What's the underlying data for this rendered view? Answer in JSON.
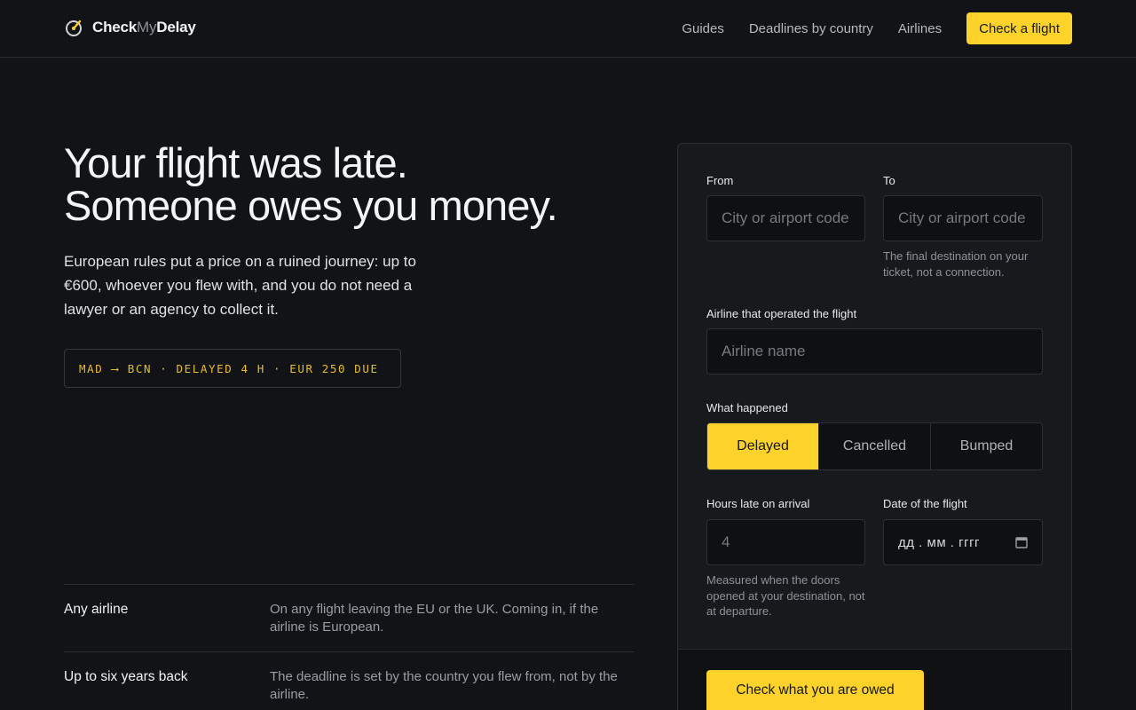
{
  "brand": {
    "name_start": "Check",
    "name_mid": "My",
    "name_end": "Delay"
  },
  "nav": {
    "links": [
      "Guides",
      "Deadlines by country",
      "Airlines"
    ],
    "cta": "Check a flight"
  },
  "hero": {
    "title_line1": "Your flight was late.",
    "title_line2": "Someone owes you money.",
    "lede": "European rules put a price on a ruined journey: up to €600, whoever you flew with, and you do not need a lawyer or an agency to collect it.",
    "ticker": "MAD ⟶ BCN · DELAYED 4 H · EUR 250 DUE"
  },
  "features": [
    {
      "name": "Any airline",
      "desc": "On any flight leaving the EU or the UK. Coming in, if the airline is European."
    },
    {
      "name": "Up to six years back",
      "desc": "The deadline is set by the country you flew from, not by the airline."
    }
  ],
  "form": {
    "from": {
      "label": "From",
      "placeholder": "City or airport code",
      "value": ""
    },
    "to": {
      "label": "To",
      "placeholder": "City or airport code",
      "value": "",
      "hint": "The final destination on your ticket, not a connection."
    },
    "airline": {
      "label": "Airline that operated the flight",
      "placeholder": "Airline name",
      "value": ""
    },
    "what_happened": {
      "label": "What happened",
      "options": [
        "Delayed",
        "Cancelled",
        "Bumped"
      ],
      "selected": "Delayed"
    },
    "hours": {
      "label": "Hours late on arrival",
      "placeholder": "4",
      "value": "",
      "hint": "Measured when the doors opened at your destination, not at departure."
    },
    "date": {
      "label": "Date of the flight",
      "placeholder": "дд . мм . гггг",
      "icon": "calendar-icon"
    },
    "submit": "Check what you are owed"
  },
  "colors": {
    "accent": "#fdd22a",
    "background": "#111316",
    "card": "#171a1d",
    "ticker": "#e6bd2a"
  }
}
